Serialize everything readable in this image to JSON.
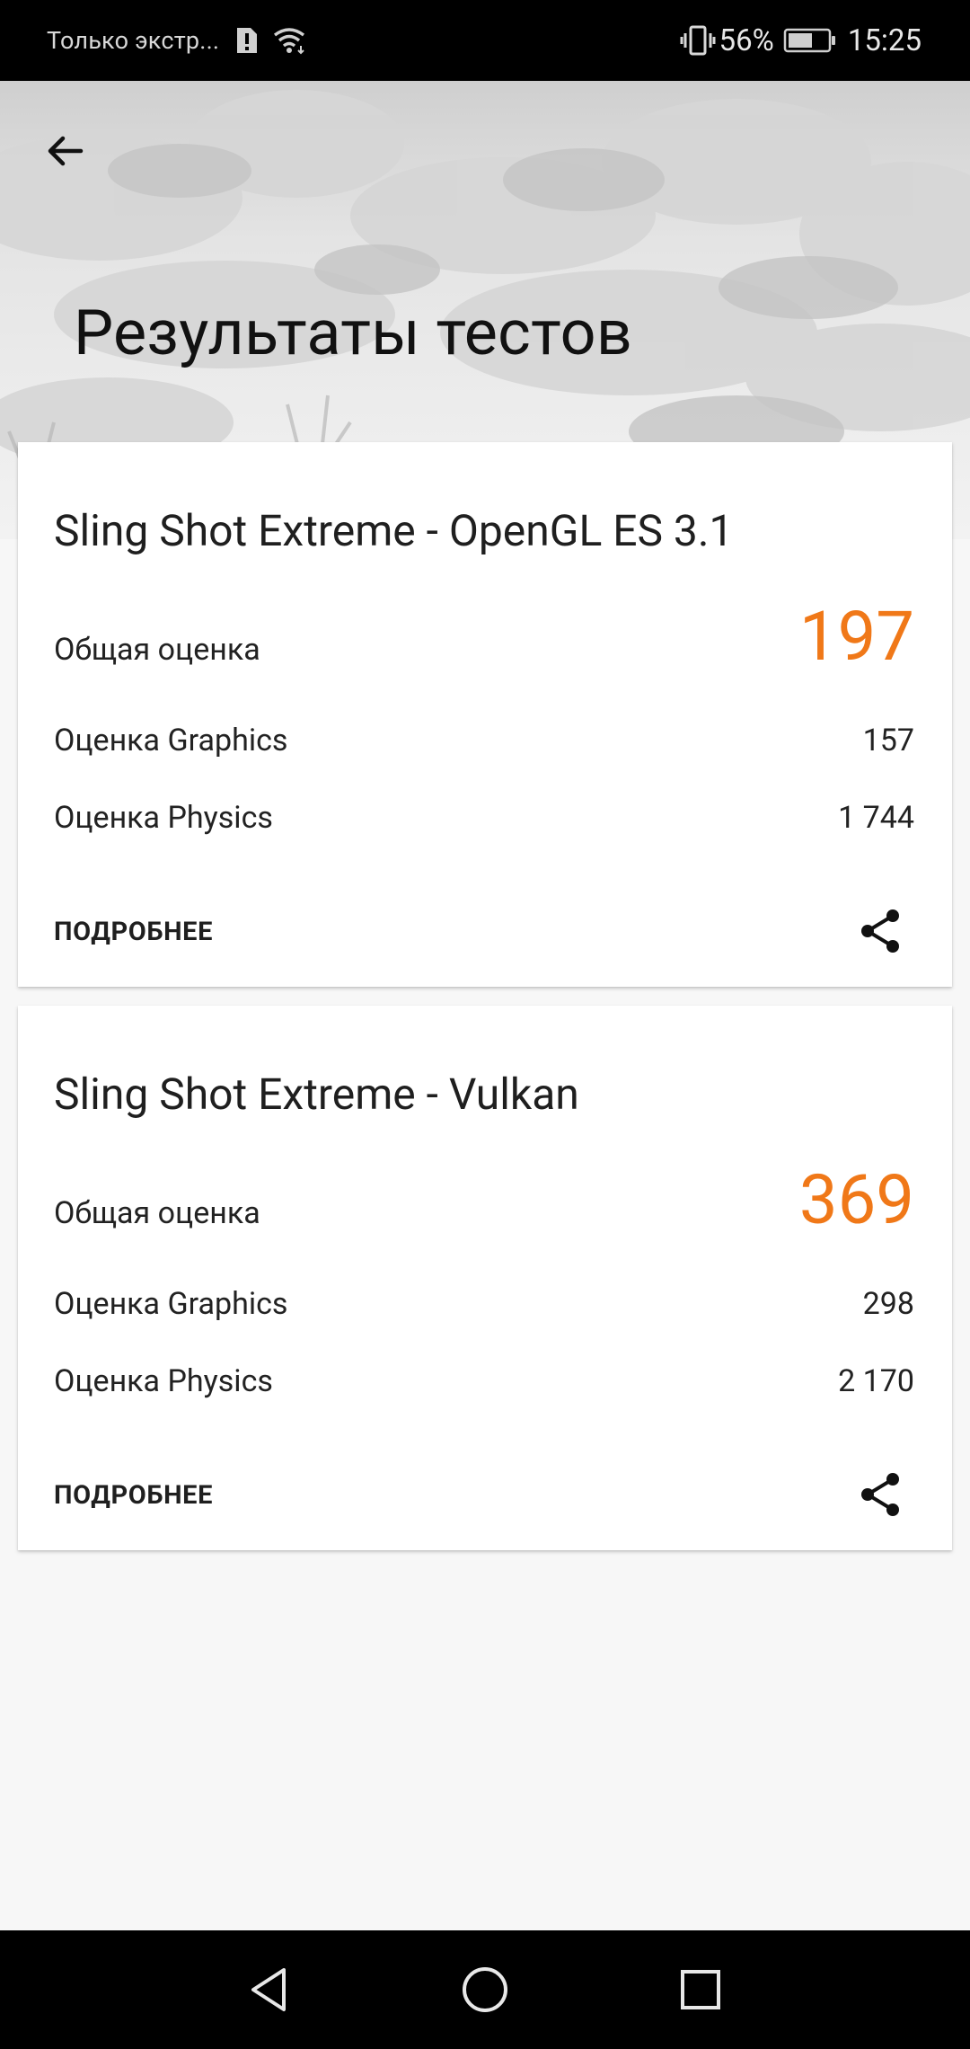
{
  "status_bar": {
    "carrier": "Только экстр...",
    "battery_percent": "56%",
    "time": "15:25"
  },
  "header": {
    "title": "Результаты тестов"
  },
  "results": [
    {
      "title": "Sling Shot Extreme - OpenGL ES 3.1",
      "overall_label": "Общая оценка",
      "overall_score": "197",
      "graphics_label": "Оценка Graphics",
      "graphics_score": "157",
      "physics_label": "Оценка Physics",
      "physics_score": "1 744",
      "details_label": "ПОДРОБНЕЕ"
    },
    {
      "title": "Sling Shot Extreme - Vulkan",
      "overall_label": "Общая оценка",
      "overall_score": "369",
      "graphics_label": "Оценка Graphics",
      "graphics_score": "298",
      "physics_label": "Оценка Physics",
      "physics_score": "2 170",
      "details_label": "ПОДРОБНЕЕ"
    }
  ],
  "colors": {
    "accent_score": "#f07818",
    "status_bar_bg": "#000000",
    "page_bg": "#f7f7f7"
  },
  "icons": {
    "back": "arrow-left-icon",
    "share": "share-icon",
    "nav_back": "triangle-back-icon",
    "nav_home": "circle-home-icon",
    "nav_recents": "square-recents-icon"
  }
}
